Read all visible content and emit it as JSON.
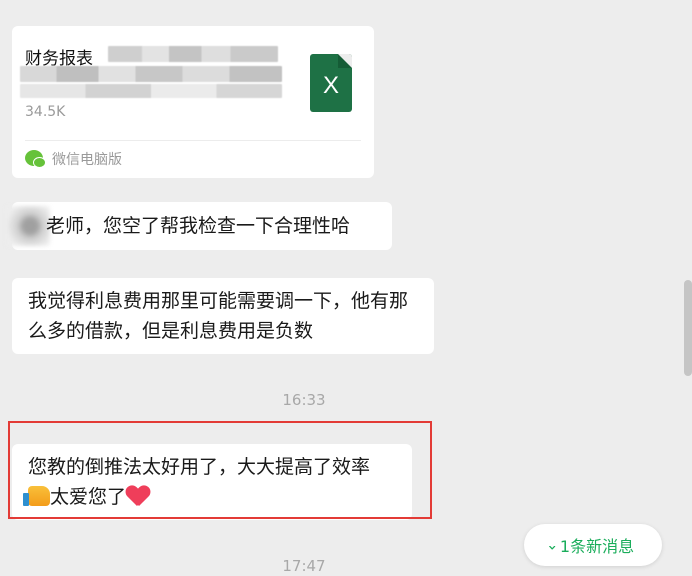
{
  "file_message": {
    "file_name": "财务报表",
    "file_size": "34.5K",
    "file_type_icon": "excel-icon",
    "file_icon_letter": "X",
    "source_label": "微信电脑版",
    "colors": {
      "excel_green": "#1e7145",
      "source_green": "#66c23a"
    }
  },
  "messages": [
    {
      "text": "老师，您空了帮我检查一下合理性哈"
    },
    {
      "text": "我觉得利息费用那里可能需要调一下，他有那么多的借款，但是利息费用是负数"
    },
    {
      "text_before": "您教的倒推法太好用了，大大提高了效率",
      "text_after": "太爱您了"
    }
  ],
  "timestamps": [
    "16:33",
    "17:47"
  ],
  "new_messages_button": {
    "label": "1条新消息",
    "color": "#1aad5b"
  },
  "highlight_color": "#e33b36"
}
